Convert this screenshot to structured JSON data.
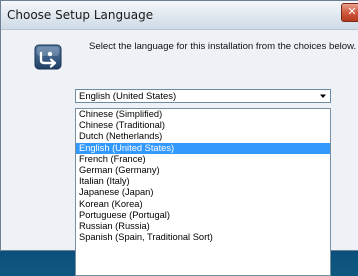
{
  "window": {
    "title": "Choose Setup Language",
    "close_label": "✕"
  },
  "prompt": "Select the language for this installation from the choices below.",
  "combo": {
    "selected_value": "English (United States)"
  },
  "list": {
    "items": [
      "Chinese (Simplified)",
      "Chinese (Traditional)",
      "Dutch (Netherlands)",
      "English (United States)",
      "French (France)",
      "German (Germany)",
      "Italian (Italy)",
      "Japanese (Japan)",
      "Korean (Korea)",
      "Portuguese (Portugal)",
      "Russian (Russia)",
      "Spanish (Spain, Traditional Sort)"
    ],
    "selected_index": 3
  },
  "colors": {
    "selection": "#3399ff",
    "close_button": "#cf5a3e"
  },
  "icons": {
    "setup": "setup-icon",
    "dropdown": "chevron-down-icon"
  }
}
